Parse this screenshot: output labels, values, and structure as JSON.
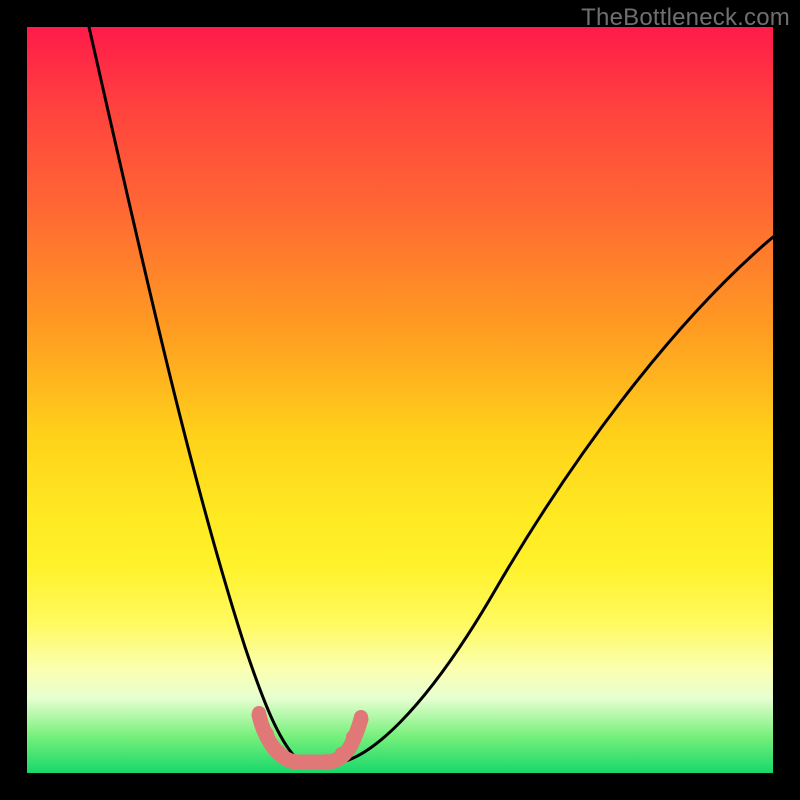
{
  "watermark": "TheBottleneck.com",
  "chart_data": {
    "type": "line",
    "title": "",
    "xlabel": "",
    "ylabel": "",
    "xlim": [
      0,
      100
    ],
    "ylim": [
      0,
      100
    ],
    "background_gradient": {
      "top": "#ff1a4a",
      "mid": "#ffe822",
      "bottom": "#17d86b"
    },
    "series": [
      {
        "name": "bottleneck-curve",
        "x": [
          0,
          5,
          10,
          15,
          20,
          24,
          27,
          30,
          32,
          34,
          36,
          38,
          40,
          43,
          47,
          52,
          58,
          65,
          73,
          82,
          92,
          100
        ],
        "values": [
          100,
          88,
          76,
          64,
          50,
          38,
          27,
          17,
          10,
          5,
          2,
          1.5,
          1.5,
          2,
          5,
          12,
          21,
          32,
          43,
          54,
          66,
          74
        ]
      }
    ],
    "highlight_region": {
      "x_start": 30,
      "x_end": 42,
      "description": "green optimal zone, pink marker band at bottom of V"
    },
    "marker_color": "#e67a7a",
    "curve_color": "#000000"
  }
}
